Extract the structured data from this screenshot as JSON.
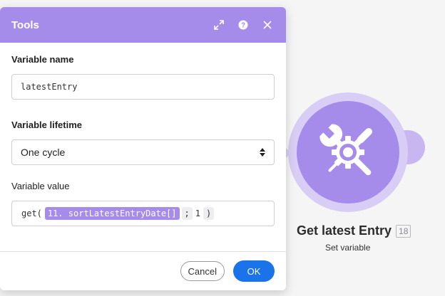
{
  "dialog": {
    "title": "Tools",
    "header_icons": [
      "expand-icon",
      "help-icon",
      "close-icon"
    ],
    "variable_name_label": "Variable name",
    "variable_name_value": "latestEntry",
    "variable_lifetime_label": "Variable lifetime",
    "variable_lifetime_value": "One cycle",
    "variable_value_label": "Variable value",
    "expression": {
      "func": "get(",
      "pill": "11. sortLatestEntryDate[]",
      "separator": ";",
      "index": "1",
      "close": ")"
    },
    "cancel_label": "Cancel",
    "ok_label": "OK"
  },
  "node": {
    "icon": "tools-icon",
    "title": "Get latest Entry",
    "badge": "18",
    "subtitle": "Set variable"
  },
  "colors": {
    "accent": "#a58cea",
    "primary_button": "#1a73e8"
  }
}
